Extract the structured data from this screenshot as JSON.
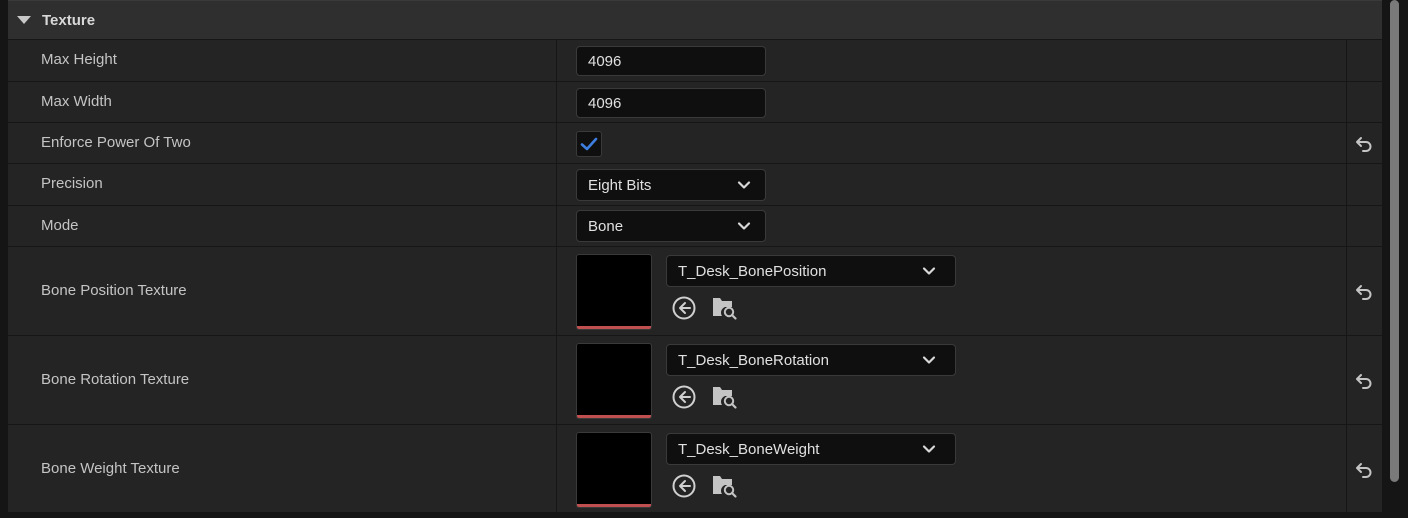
{
  "section": {
    "title": "Texture"
  },
  "rows": {
    "max_height": {
      "label": "Max Height",
      "value": "4096"
    },
    "max_width": {
      "label": "Max Width",
      "value": "4096"
    },
    "enforce_pow2": {
      "label": "Enforce Power Of Two",
      "checked": true
    },
    "precision": {
      "label": "Precision",
      "value": "Eight Bits"
    },
    "mode": {
      "label": "Mode",
      "value": "Bone"
    },
    "bone_position": {
      "label": "Bone Position Texture",
      "asset": "T_Desk_BonePosition"
    },
    "bone_rotation": {
      "label": "Bone Rotation Texture",
      "asset": "T_Desk_BoneRotation"
    },
    "bone_weight": {
      "label": "Bone Weight Texture",
      "asset": "T_Desk_BoneWeight"
    }
  },
  "icons": {
    "collapse": "triangle-down-icon",
    "check": "checkmark-icon",
    "dropdown": "chevron-down-icon",
    "use_selected": "arrow-left-circle-icon",
    "browse": "folder-search-icon",
    "reset": "reset-arrow-icon"
  },
  "colors": {
    "panel_bg": "#242424",
    "header_bg": "#2f2f2f",
    "input_bg": "#0f0f0f",
    "check_accent": "#3d7ee0",
    "thumb_bar": "#c05050"
  }
}
